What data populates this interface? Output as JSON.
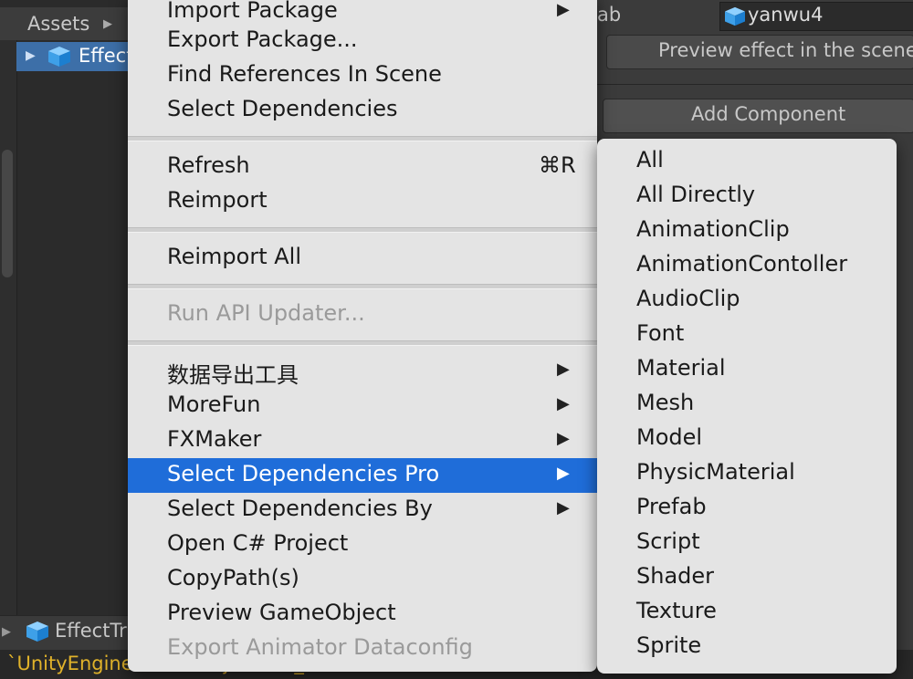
{
  "left_panel": {
    "assets_label": "Assets",
    "tree_item": "EffectTrigger",
    "bottom_object": "EffectTrigger"
  },
  "inspector": {
    "field_label_tail": "ab",
    "object_field_value": "yanwu4",
    "preview_button": "Preview effect in the scene",
    "add_component_button": "Add Component"
  },
  "console": {
    "message": "`UnityEngine.GameObject:set_name - true"
  },
  "context_menu": {
    "items": [
      {
        "label": "Import Package",
        "arrow": "▶"
      },
      {
        "label": "Export Package..."
      },
      {
        "label": "Find References In Scene"
      },
      {
        "label": "Select Dependencies"
      },
      {
        "label": "Refresh",
        "shortcut": "⌘R"
      },
      {
        "label": "Reimport"
      },
      {
        "label": "Reimport All"
      },
      {
        "label": "Run API Updater...",
        "disabled": true
      },
      {
        "label": "数据导出工具",
        "arrow": "▶"
      },
      {
        "label": "MoreFun",
        "arrow": "▶"
      },
      {
        "label": "FXMaker",
        "arrow": "▶"
      },
      {
        "label": "Select Dependencies Pro",
        "arrow": "▶",
        "highlighted": true
      },
      {
        "label": "Select Dependencies By",
        "arrow": "▶"
      },
      {
        "label": "Open C# Project"
      },
      {
        "label": "CopyPath(s)"
      },
      {
        "label": "Preview GameObject"
      },
      {
        "label": "Export Animator Dataconfig",
        "disabled": true
      }
    ]
  },
  "submenu": {
    "items": [
      "All",
      "All Directly",
      "AnimationClip",
      "AnimationContoller",
      "AudioClip",
      "Font",
      "Material",
      "Mesh",
      "Model",
      "PhysicMaterial",
      "Prefab",
      "Script",
      "Shader",
      "Texture",
      "Sprite"
    ]
  },
  "colors": {
    "menu_bg": "#e4e4e4",
    "highlight": "#1f6dd9",
    "selection_row": "#3d6fa8",
    "console_text": "#e0b22a"
  }
}
